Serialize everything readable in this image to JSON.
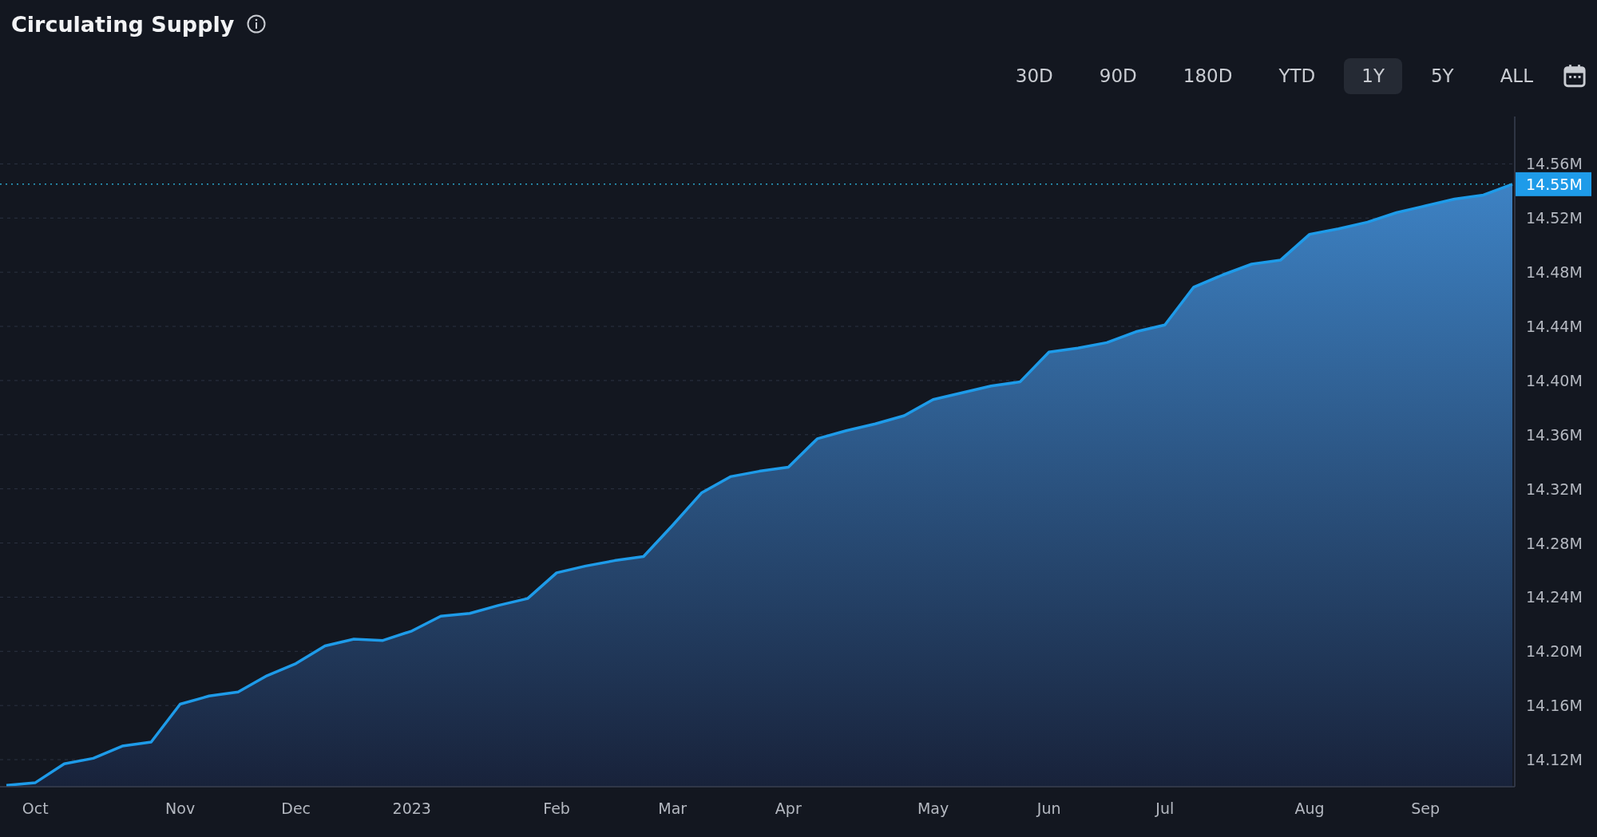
{
  "header": {
    "title": "Circulating Supply"
  },
  "ranges": [
    {
      "label": "30D",
      "selected": false
    },
    {
      "label": "90D",
      "selected": false
    },
    {
      "label": "180D",
      "selected": false
    },
    {
      "label": "YTD",
      "selected": false
    },
    {
      "label": "1Y",
      "selected": true
    },
    {
      "label": "5Y",
      "selected": false
    },
    {
      "label": "ALL",
      "selected": false
    }
  ],
  "chart": {
    "chart_data": {
      "type": "area",
      "grid": true,
      "ref_lines": [
        {
          "axis": "y",
          "value": 14.545,
          "label": "14.55M",
          "color": "#2aa3c8"
        }
      ],
      "categories": [
        null,
        "Oct",
        null,
        null,
        null,
        null,
        "Nov",
        null,
        null,
        null,
        "Dec",
        null,
        null,
        null,
        "2023",
        null,
        null,
        null,
        null,
        "Feb",
        null,
        null,
        null,
        "Mar",
        null,
        null,
        null,
        "Apr",
        null,
        null,
        null,
        null,
        "May",
        null,
        null,
        null,
        "Jun",
        null,
        null,
        null,
        "Jul",
        null,
        null,
        null,
        null,
        "Aug",
        null,
        null,
        null,
        "Sep",
        null,
        null,
        null
      ],
      "series": [
        {
          "color": "#1e9be9",
          "values": [
            14.101,
            14.103,
            14.117,
            14.121,
            14.13,
            14.133,
            14.161,
            14.167,
            14.17,
            14.182,
            14.191,
            14.204,
            14.209,
            14.208,
            14.215,
            14.226,
            14.228,
            14.234,
            14.239,
            14.258,
            14.263,
            14.267,
            14.27,
            14.293,
            14.317,
            14.329,
            14.333,
            14.336,
            14.357,
            14.363,
            14.368,
            14.374,
            14.386,
            14.391,
            14.396,
            14.399,
            14.421,
            14.424,
            14.428,
            14.436,
            14.441,
            14.469,
            14.478,
            14.486,
            14.489,
            14.508,
            14.512,
            14.517,
            14.524,
            14.529,
            14.534,
            14.537,
            14.545
          ]
        }
      ],
      "ylim": [
        14.1,
        14.595
      ],
      "yticks": [
        {
          "value": 14.12,
          "label": "14.12M"
        },
        {
          "value": 14.16,
          "label": "14.16M"
        },
        {
          "value": 14.2,
          "label": "14.20M"
        },
        {
          "value": 14.24,
          "label": "14.24M"
        },
        {
          "value": 14.28,
          "label": "14.28M"
        },
        {
          "value": 14.32,
          "label": "14.32M"
        },
        {
          "value": 14.36,
          "label": "14.36M"
        },
        {
          "value": 14.4,
          "label": "14.40M"
        },
        {
          "value": 14.44,
          "label": "14.44M"
        },
        {
          "value": 14.48,
          "label": "14.48M"
        },
        {
          "value": 14.52,
          "label": "14.52M"
        },
        {
          "value": 14.56,
          "label": "14.56M"
        }
      ]
    }
  }
}
